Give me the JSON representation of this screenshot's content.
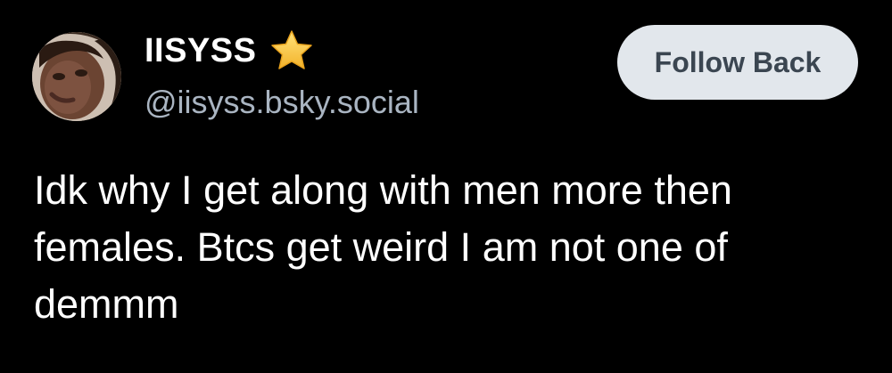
{
  "author": {
    "display_name": "IISYSS",
    "badge_icon": "star-icon",
    "handle": "@iisyss.bsky.social",
    "avatar_icon": "avatar"
  },
  "actions": {
    "follow_label": "Follow Back"
  },
  "post": {
    "lines": [
      "Idk why I get along with men more then",
      "females. Btcs get weird I am not one of",
      "demmm"
    ]
  },
  "colors": {
    "background": "#000000",
    "text": "#ffffff",
    "handle": "#aab5c2",
    "button_bg": "#e2e7ec",
    "button_text": "#3b4651",
    "star": "#f6c642"
  }
}
